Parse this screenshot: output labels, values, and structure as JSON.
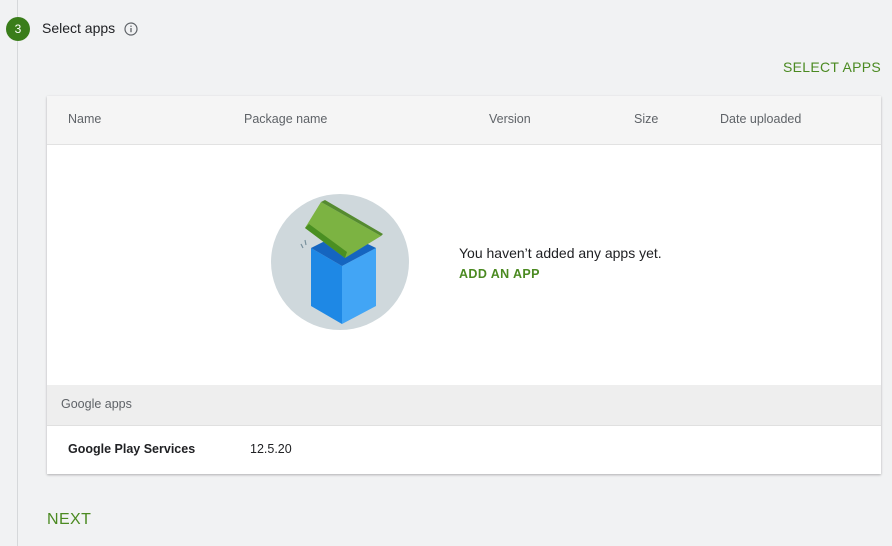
{
  "step": {
    "number": "3",
    "title": "Select apps",
    "info_icon": "info-icon"
  },
  "actions": {
    "select_apps_label": "SELECT APPS",
    "next_label": "NEXT"
  },
  "table": {
    "columns": [
      "Name",
      "Package name",
      "Version",
      "Size",
      "Date uploaded"
    ],
    "empty_state": {
      "message": "You haven’t added any apps yet.",
      "add_label": "ADD AN APP",
      "illustration_icon": "empty-box-icon"
    },
    "section": {
      "label": "Google apps",
      "rows": [
        {
          "name": "Google Play Services",
          "version": "12.5.20"
        }
      ]
    }
  },
  "colors": {
    "accent": "#4b8a21",
    "step_badge": "#3a7d1a",
    "box_blue": "#2196f3",
    "lid_green": "#4caf50"
  }
}
